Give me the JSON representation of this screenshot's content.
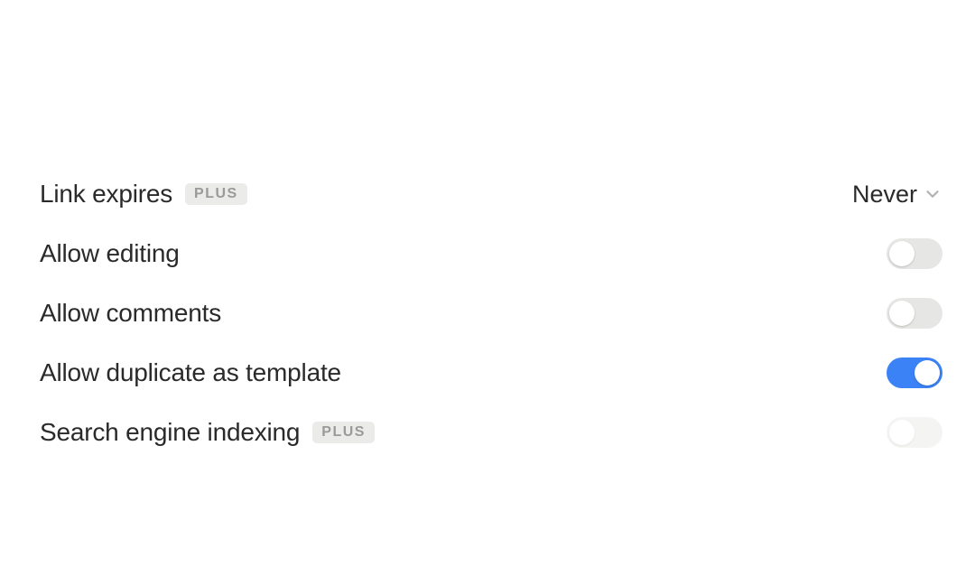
{
  "settings": {
    "link_expires": {
      "label": "Link expires",
      "badge": "PLUS",
      "value": "Never"
    },
    "allow_editing": {
      "label": "Allow editing",
      "state": "off"
    },
    "allow_comments": {
      "label": "Allow comments",
      "state": "off"
    },
    "allow_duplicate": {
      "label": "Allow duplicate as template",
      "state": "on"
    },
    "search_indexing": {
      "label": "Search engine indexing",
      "badge": "PLUS",
      "state": "disabled"
    }
  }
}
